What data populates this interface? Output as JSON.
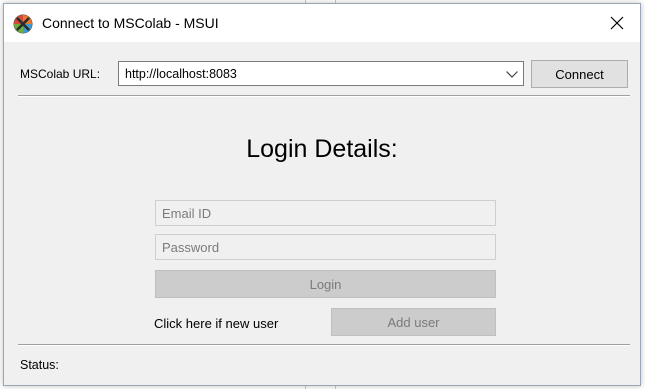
{
  "window": {
    "title": "Connect to MSColab - MSUI"
  },
  "connection": {
    "url_label": "MSColab URL:",
    "url_value": "http://localhost:8083",
    "connect_label": "Connect"
  },
  "login": {
    "heading": "Login Details:",
    "email_placeholder": "Email ID",
    "password_placeholder": "Password",
    "login_label": "Login",
    "new_user_text": "Click here if new user",
    "add_user_label": "Add user"
  },
  "status": {
    "label": "Status:"
  },
  "icons": {
    "app": "msui-app-icon",
    "close": "close-icon",
    "dropdown": "chevron-down-icon"
  },
  "colors": {
    "window_background": "#f0f0f0",
    "titlebar_background": "#ffffff",
    "disabled_button": "#cccccc"
  }
}
